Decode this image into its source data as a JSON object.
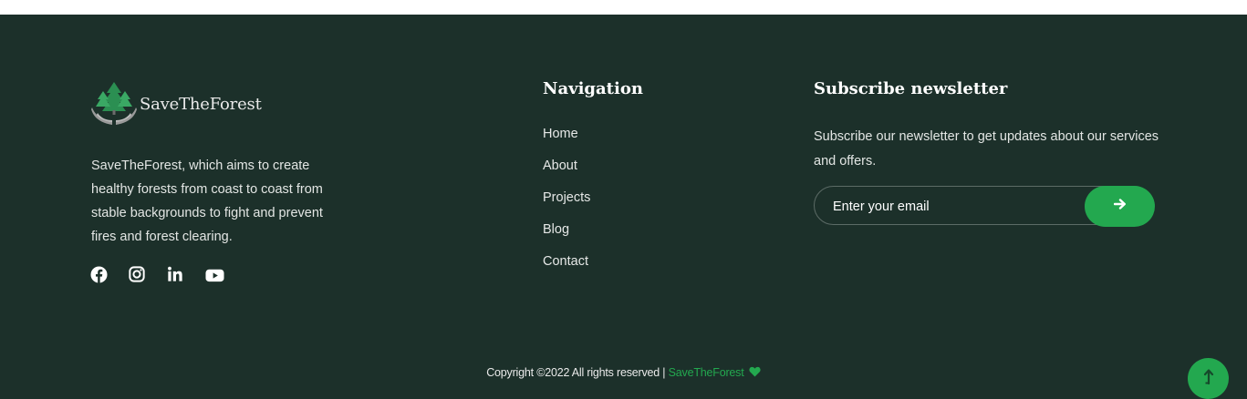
{
  "brand": {
    "name": "SaveTheForest",
    "logo_icon": "tree-hands-logo",
    "description": "SaveTheForest, which aims to create healthy forests from coast to coast from stable backgrounds to fight and prevent fires and forest clearing."
  },
  "social": [
    {
      "icon": "facebook-icon"
    },
    {
      "icon": "instagram-icon"
    },
    {
      "icon": "linkedin-icon"
    },
    {
      "icon": "youtube-icon"
    }
  ],
  "navigation": {
    "title": "Navigation",
    "items": [
      {
        "label": "Home"
      },
      {
        "label": "About"
      },
      {
        "label": "Projects"
      },
      {
        "label": "Blog"
      },
      {
        "label": "Contact"
      }
    ]
  },
  "newsletter": {
    "title": "Subscribe newsletter",
    "text": "Subscribe our newsletter to get updates about our services and offers.",
    "email_placeholder": "Enter your email",
    "submit_icon": "arrow-right-icon"
  },
  "copyright": {
    "text": "Copyright ©2022 All rights reserved | ",
    "brand": "SaveTheForest",
    "icon": "heart-icon"
  },
  "back_to_top": {
    "icon": "arrow-up-icon"
  },
  "colors": {
    "background": "#1c302a",
    "accent": "#23a84f",
    "text": "#e3e6e4"
  }
}
